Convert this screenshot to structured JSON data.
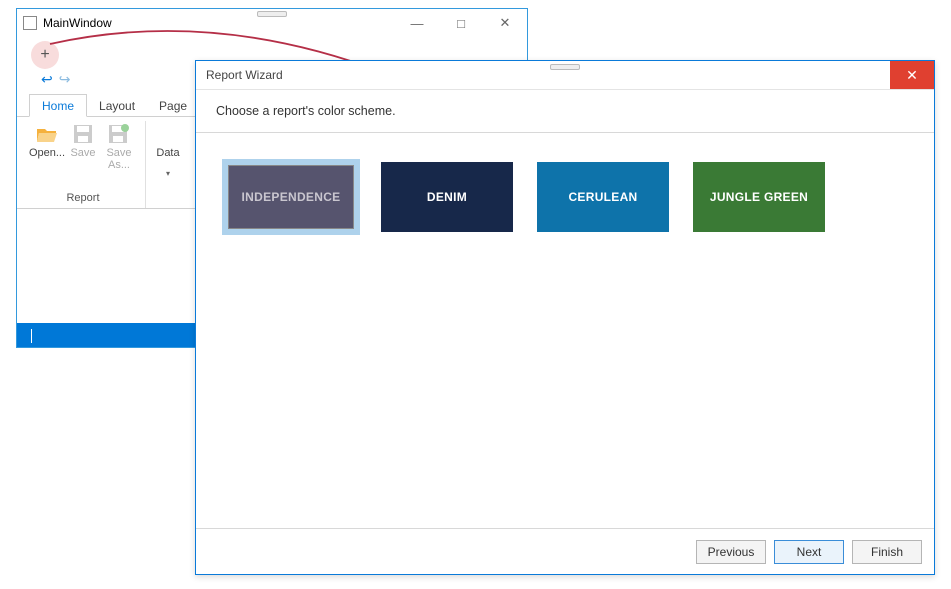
{
  "main_window": {
    "title": "MainWindow",
    "plus_label": "+",
    "tabs": {
      "home": "Home",
      "layout": "Layout",
      "page": "Page"
    },
    "ribbon": {
      "open": "Open...",
      "save": "Save",
      "saveas": "Save As...",
      "data": "Data",
      "group_report": "Report"
    }
  },
  "wizard": {
    "title": "Report Wizard",
    "prompt": "Choose a report's color scheme.",
    "schemes": [
      {
        "name": "INDEPENDENCE",
        "color": "#56546e",
        "selected": true
      },
      {
        "name": "DENIM",
        "color": "#17284a",
        "selected": false
      },
      {
        "name": "CERULEAN",
        "color": "#0e73aa",
        "selected": false
      },
      {
        "name": "JUNGLE GREEN",
        "color": "#3a7a35",
        "selected": false
      }
    ],
    "buttons": {
      "previous": "Previous",
      "next": "Next",
      "finish": "Finish"
    }
  }
}
